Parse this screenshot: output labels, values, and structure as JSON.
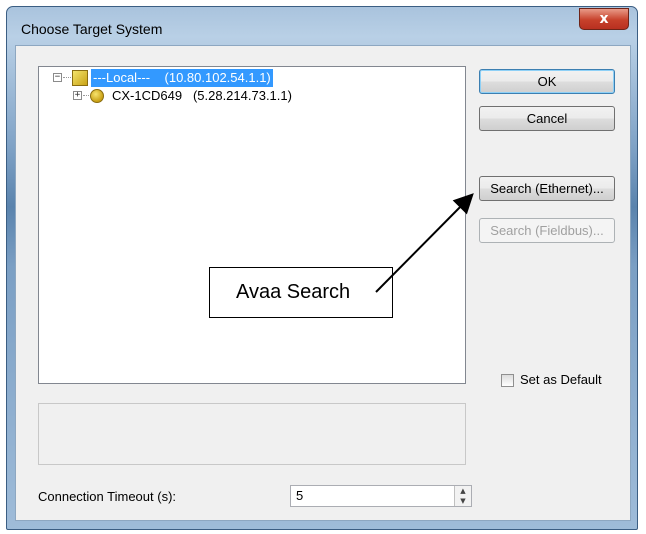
{
  "window": {
    "title": "Choose Target System",
    "close_label": "x"
  },
  "tree": {
    "root": {
      "expander": "−",
      "name": "---Local---",
      "address": "(10.80.102.54.1.1)",
      "icon": "local-system-icon"
    },
    "child": {
      "expander": "+",
      "name": "CX-1CD649",
      "address": "(5.28.214.73.1.1)",
      "icon": "cx-device-icon"
    }
  },
  "buttons": {
    "ok": "OK",
    "cancel": "Cancel",
    "search_ethernet": "Search (Ethernet)...",
    "search_fieldbus": "Search (Fieldbus)..."
  },
  "set_default": {
    "label": "Set as Default",
    "checked": false
  },
  "timeout": {
    "label": "Connection Timeout (s):",
    "value": "5",
    "up": "▲",
    "down": "▼"
  },
  "annotation": {
    "text": "Avaa Search"
  },
  "colors": {
    "selection": "#3399ff",
    "close_button": "#c7412b",
    "dialog_background": "#f0f0f0"
  }
}
